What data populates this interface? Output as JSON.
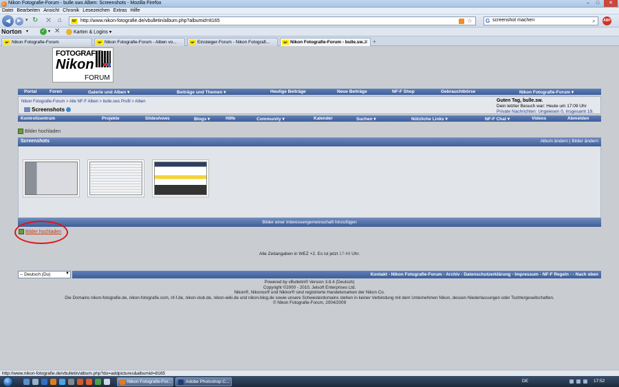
{
  "window": {
    "title": "Nikon Fotografie-Forum - bulle.sws Alben: Screenshots - Mozilla Firefox",
    "controls": [
      "–",
      "□",
      "✕"
    ]
  },
  "menu": [
    "Datei",
    "Bearbeiten",
    "Ansicht",
    "Chronik",
    "Lesezeichen",
    "Extras",
    "Hilfe"
  ],
  "toolbar": {
    "url": "http://www.nikon-fotografie.de/vbulletin/album.php?albumid=8165",
    "search_value": "screenshot machen",
    "favicon_text": "NF",
    "abp_label": "ABP"
  },
  "norton": {
    "brand": "Norton",
    "karten_logins": "Karten & Logins"
  },
  "tabs": [
    {
      "label": "Nikon Fotografie-Forum",
      "active": false
    },
    {
      "label": "Nikon Fotografie-Forum - Alben vo...",
      "active": false
    },
    {
      "label": "Einsteiger-Forum - Nikon Fotografi...",
      "active": false
    },
    {
      "label": "Nikon Fotografie-Forum - bulle.sw...",
      "active": true
    }
  ],
  "logo": {
    "line1": "FOTOGRAFIE",
    "line2": "Nikon",
    "line3": "FORUM"
  },
  "mainnav": [
    {
      "label": "Portal"
    },
    {
      "label": "Foren"
    },
    {
      "label": "Galerie und Alben ▾"
    },
    {
      "label": "Beiträge und Themen ▾"
    },
    {
      "label": "Heutige Beiträge"
    },
    {
      "label": "Neue Beiträge"
    },
    {
      "label": "NF-F Shop"
    },
    {
      "label": "Gebrauchtbörse"
    },
    {
      "label": "Nikon Fotografie-Forum ▾"
    }
  ],
  "breadcrumb": {
    "path": "Nikon Fotografie-Forum > Alle NF-F Alben > bulle.sws Profil > Alben",
    "current": "Screenshots"
  },
  "welcome": {
    "greeting": "Guten Tag, bulle.sw.",
    "last_visit": "Dein letzter Besuch war: Heute um 17:09 Uhr",
    "messages": "Private Nachrichten: Ungelesen 0, insgesamt 19."
  },
  "subnav": [
    {
      "label": "Kontrollzentrum"
    },
    {
      "label": "Projekte"
    },
    {
      "label": "Slideshows"
    },
    {
      "label": "Blogs ▾"
    },
    {
      "label": "Hilfe"
    },
    {
      "label": "Community ▾"
    },
    {
      "label": "Kalender"
    },
    {
      "label": "Suchen ▾"
    },
    {
      "label": "Nützliche Links ▾"
    },
    {
      "label": "NF-F Chat ▾"
    },
    {
      "label": "Videos"
    },
    {
      "label": "Abmelden"
    }
  ],
  "album": {
    "upload_label": "Bilder hochladen",
    "title": "Screenshots",
    "actions": "Album ändern | Bilder ändern",
    "group_bar": "Bilder einer Interessengemeinschaft hinzufügen",
    "upload_label_2": "Bilder hochladen"
  },
  "timezone": {
    "text": "Alle Zeitangaben in WEZ +2. Es ist jetzt",
    "time": "17:49",
    "suffix": "Uhr."
  },
  "footer": {
    "language": "-- Deutsch (Du)",
    "links": "Kontakt - Nikon Fotografie-Forum - Archiv - Datenschutzerklärung - Impressum - NF-F Regeln - - Nach oben",
    "legal": [
      "Powered by vBulletin® Version 3.8.4 (Deutsch)",
      "Copyright ©2000 - 2010, Jelsoft Enterprises Ltd.",
      "Nikon®, Nikonos® und Nikkor® sind registrierte Handelsmarken der Nikon Co.",
      "Die Domains nikon-fotografie.de, nikon-fotografie.com, nf-f.de, nikon-club.de, nikon-wiki.de und nikon-blog.de sowie unsere Schwesterdomains stehen in keiner Verbindung mit dem Unternehmen Nikon, dessen Niederlassungen oder Tochtergesellschaften.",
      "© Nikon Fotografie-Forum, 2004/2009"
    ]
  },
  "statusbar": "http://www.nikon-fotografie.de/vbulletin/album.php?do=addpictures&albumid=8165",
  "taskbar": {
    "tasks": [
      {
        "label": "Nikon Fotografie-For...",
        "active": true
      },
      {
        "label": "Adobe Photoshop C...",
        "active": false
      }
    ],
    "lang": "DE",
    "clock": "17:52"
  }
}
